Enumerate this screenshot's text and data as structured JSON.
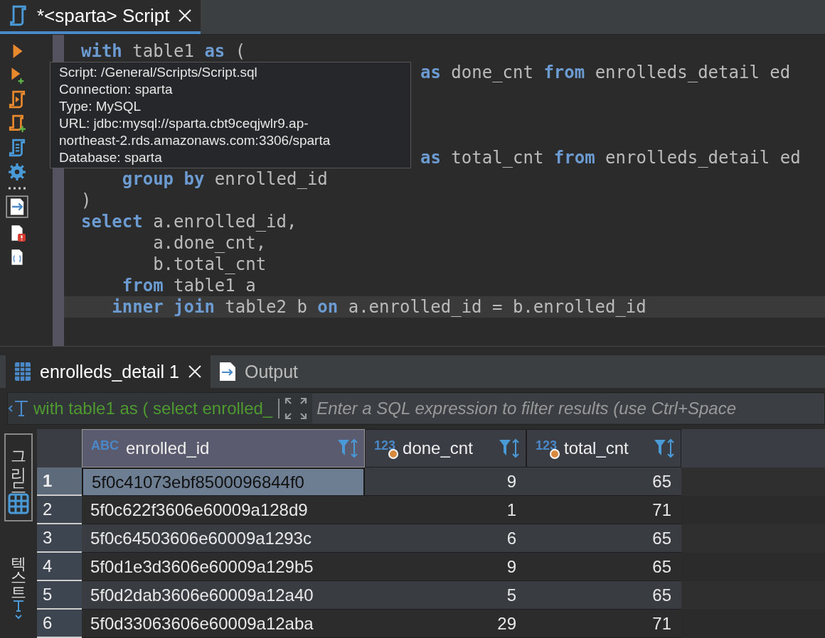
{
  "editor_tabs": [
    {
      "label": "*<sparta> Script",
      "selected": true
    }
  ],
  "tooltip": [
    "Script: /General/Scripts/Script.sql",
    "Connection: sparta",
    "Type: MySQL",
    "URL: jdbc:mysql://sparta.cbt9ceqjwlr9.ap-",
    "northeast-2.rds.amazonaws.com:3306/sparta",
    "Database: sparta"
  ],
  "code_lines": [
    {
      "current": false,
      "tokens": [
        {
          "kind": "keyword",
          "text": "with"
        },
        {
          "kind": "plain",
          "text": " table1 "
        },
        {
          "kind": "keyword",
          "text": "as"
        },
        {
          "kind": "plain",
          "text": " ("
        }
      ]
    },
    {
      "current": false,
      "covered_start": true,
      "tokens": [
        {
          "kind": "keyword",
          "text": "as"
        },
        {
          "kind": "plain",
          "text": " done_cnt "
        },
        {
          "kind": "keyword",
          "text": "from"
        },
        {
          "kind": "plain",
          "text": " enrolleds_detail ed"
        }
      ]
    },
    {
      "current": false
    },
    {
      "current": false
    },
    {
      "current": false
    },
    {
      "current": false,
      "covered_start": true,
      "tokens": [
        {
          "kind": "keyword",
          "text": "as"
        },
        {
          "kind": "plain",
          "text": " total_cnt "
        },
        {
          "kind": "keyword",
          "text": "from"
        },
        {
          "kind": "plain",
          "text": " enrolleds_detail ed"
        }
      ]
    },
    {
      "current": false,
      "tokens": [
        {
          "kind": "keyword",
          "text": "    group by"
        },
        {
          "kind": "plain",
          "text": " enrolled_id"
        }
      ]
    },
    {
      "current": false,
      "tokens": [
        {
          "kind": "plain",
          "text": ")"
        }
      ]
    },
    {
      "current": false,
      "tokens": [
        {
          "kind": "keyword",
          "text": "select"
        },
        {
          "kind": "plain",
          "text": " a.enrolled_id,"
        }
      ]
    },
    {
      "current": false,
      "tokens": [
        {
          "kind": "plain",
          "text": "       a.done_cnt,"
        }
      ]
    },
    {
      "current": false,
      "tokens": [
        {
          "kind": "plain",
          "text": "       b.total_cnt"
        }
      ]
    },
    {
      "current": false,
      "tokens": [
        {
          "kind": "keyword",
          "text": "    from"
        },
        {
          "kind": "plain",
          "text": " table1 a"
        }
      ]
    },
    {
      "current": true,
      "tokens": [
        {
          "kind": "keyword",
          "text": "   inner join"
        },
        {
          "kind": "plain",
          "text": " table2 b "
        },
        {
          "kind": "keyword",
          "text": "on"
        },
        {
          "kind": "plain",
          "text": " a.enrolled_id = b.enrolled_id"
        }
      ]
    }
  ],
  "result_tabs": [
    {
      "label": "enrolleds_detail 1",
      "selected": true,
      "kind": "grid"
    },
    {
      "label": "Output",
      "selected": false,
      "kind": "output"
    }
  ],
  "filter": {
    "query": "with table1 as ( select enrolled_",
    "placeholder": "Enter a SQL expression to filter results (use Ctrl+Space"
  },
  "side_tabs": [
    {
      "label": "그리드",
      "selected": true,
      "kind": "grid"
    },
    {
      "label": "텍스트",
      "selected": false,
      "kind": "text"
    }
  ],
  "columns": [
    {
      "name": "enrolled_id",
      "type_label": "ABC",
      "kind": "text",
      "selected": true
    },
    {
      "name": "done_cnt",
      "type_label": "123",
      "kind": "number",
      "selected": false
    },
    {
      "name": "total_cnt",
      "type_label": "123",
      "kind": "number",
      "selected": false
    }
  ],
  "rows": [
    {
      "num": "1",
      "selected": true,
      "cells": [
        "5f0c41073ebf8500096844f0",
        "9",
        "65"
      ]
    },
    {
      "num": "2",
      "selected": false,
      "cells": [
        "5f0c622f3606e60009a128d9",
        "1",
        "71"
      ]
    },
    {
      "num": "3",
      "selected": false,
      "cells": [
        "5f0c64503606e60009a1293c",
        "6",
        "65"
      ]
    },
    {
      "num": "4",
      "selected": false,
      "cells": [
        "5f0d1e3d3606e60009a129b5",
        "9",
        "65"
      ]
    },
    {
      "num": "5",
      "selected": false,
      "cells": [
        "5f0d2dab3606e60009a12a40",
        "5",
        "65"
      ]
    },
    {
      "num": "6",
      "selected": false,
      "cells": [
        "5f0d33063606e60009a12aba",
        "29",
        "71"
      ]
    }
  ]
}
